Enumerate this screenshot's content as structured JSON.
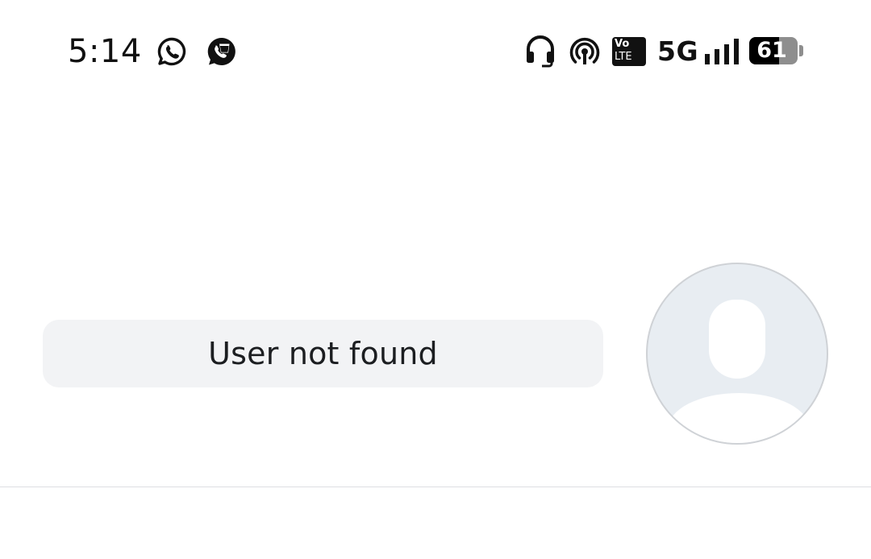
{
  "status_bar": {
    "time": "5:14",
    "network_type": "5G",
    "volte_top": "Vo",
    "volte_bottom": "LTE",
    "battery_level": "61",
    "battery_fraction": 0.61,
    "notification_icons": [
      "whatsapp-icon",
      "whatsapp-business-icon"
    ],
    "system_icons": [
      "headset-icon",
      "hotspot-icon",
      "volte-icon",
      "signal-icon",
      "battery-icon"
    ]
  },
  "content": {
    "message": "User not found",
    "avatar_icon": "default-user-avatar"
  },
  "colors": {
    "bubble_background": "#f2f3f5",
    "avatar_background": "#e8edf2",
    "text": "#1c1e21",
    "divider": "#dddfe2"
  }
}
